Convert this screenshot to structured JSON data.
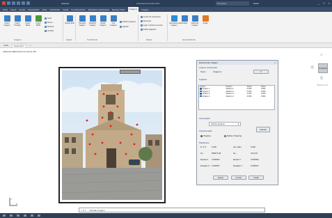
{
  "title_bar": {
    "document": "Autocad",
    "app": "Autodesk AutoCAD 2021",
    "search_placeholder": "Pesquisar",
    "user": "Entrar",
    "window_controls": [
      "_",
      "□",
      "×"
    ]
  },
  "menu": [
    "Início",
    "Inserir",
    "Anotar",
    "Paramétrico",
    "Vista",
    "Administrar",
    "Saída",
    "Complementos",
    "Aplicativos destacados",
    "Express Tools",
    "Imagens",
    "Imagem"
  ],
  "active_menu": "Imagens",
  "ribbon": {
    "tools": [
      {
        "label": "Inserir imagem",
        "icon": "insert-image-icon",
        "color": "#3a7fc6"
      },
      {
        "label": "Inserir Posição",
        "icon": "insert-position-icon",
        "color": "#3a7fc6"
      },
      {
        "label": "Inserir Mapa",
        "icon": "insert-map-icon",
        "color": "#3a7fc6"
      },
      {
        "label": "Inserir WMS",
        "icon": "insert-wms-icon",
        "color": "#4a9a3a"
      },
      {
        "label": "Ajustar Exib",
        "icon": "adjust-icon",
        "color": "#3a7fc6"
      },
      {
        "label": "Transferir imagem",
        "icon": "transfer-icon",
        "color": "#3a7fc6"
      },
      {
        "label": "Redefinir imagem",
        "icon": "redefine-icon",
        "color": "#3a7fc6"
      },
      {
        "label": "Dividir imagem",
        "icon": "split-icon",
        "color": "#3a7fc6"
      },
      {
        "label": "Unir imagens",
        "icon": "merge-icon",
        "color": "#3a7fc6"
      },
      {
        "label": "Georeferenciar imagem",
        "icon": "georef-icon",
        "color": "#2a8fd6"
      },
      {
        "label": "Realçar",
        "icon": "enhance-icon",
        "color": "#3a7fc6"
      },
      {
        "label": "Deformar imagem",
        "icon": "warp-icon",
        "color": "#3a7fc6"
      },
      {
        "label": "Ajuda",
        "icon": "help-icon",
        "color": "#e07b20"
      }
    ],
    "small_buttons": [
      "Girar",
      "Mover",
      "Mostrar",
      "Ocultar",
      "Dividir poligono",
      "Ajustar",
      "Limite de referência",
      "Remover",
      "Ligar manual a pontos",
      "Editar ligações"
    ],
    "panels": [
      "Imagens",
      "Ajustar",
      "Transformar",
      "Raster",
      "Georreferência"
    ]
  },
  "tabs": [
    "Início",
    "Desenho1*"
  ],
  "active_tab": "Desenho1*",
  "view_label": "[-][Superior][Estrutura de arame 2D]",
  "dialog": {
    "title": "Referenciar imagem",
    "section_selected": "Imagem selecionada",
    "selected_label": "Nome",
    "selected_value": "Imagem-1",
    "section_links": "Ligações",
    "columns": [
      "Origem",
      "Destino",
      "Resid",
      "Resid"
    ],
    "rows": [
      [
        "Origem 1",
        "Destino 1",
        "0.000",
        "0.000"
      ],
      [
        "Origem 2",
        "Destino 2",
        "0.000",
        "0.000"
      ],
      [
        "Origem 3",
        "Destino 3",
        "0.000",
        "0.000"
      ],
      [
        "Origem 4",
        "Destino 4",
        "0.000",
        "0.000"
      ]
    ],
    "section_interp": "Interpolação",
    "interp_value": "Vizinho próximo",
    "section_transform": "Transformação",
    "transform_options": [
      "Projetiva",
      "Rubber Sheeting"
    ],
    "transform_selected": "Projetiva",
    "calc_button": "Calcular",
    "section_params": "Parâmetros",
    "params": [
      [
        "D. X/Y:",
        "0.000",
        "Ass. Máx:",
        "0.000"
      ],
      [
        "Ox:",
        "955570.28",
        "Oy:",
        "4711.65"
      ],
      [
        "Escala X:",
        "0.000094",
        "Escala Y:",
        "0.000094"
      ],
      [
        "Rotação X:",
        "0.000537",
        "Rotação Y:",
        "0.000537"
      ]
    ],
    "buttons": [
      "Aplicar",
      "Aceitar",
      "Anular"
    ]
  },
  "command_line": {
    "icons": [
      "×",
      "⚲",
      "▾"
    ],
    "placeholder": "Insira um comando",
    "text": "Inclusão imagem"
  },
  "nav": {
    "viewcube": "SUPERIOR",
    "wcs": "Sistema UC"
  }
}
